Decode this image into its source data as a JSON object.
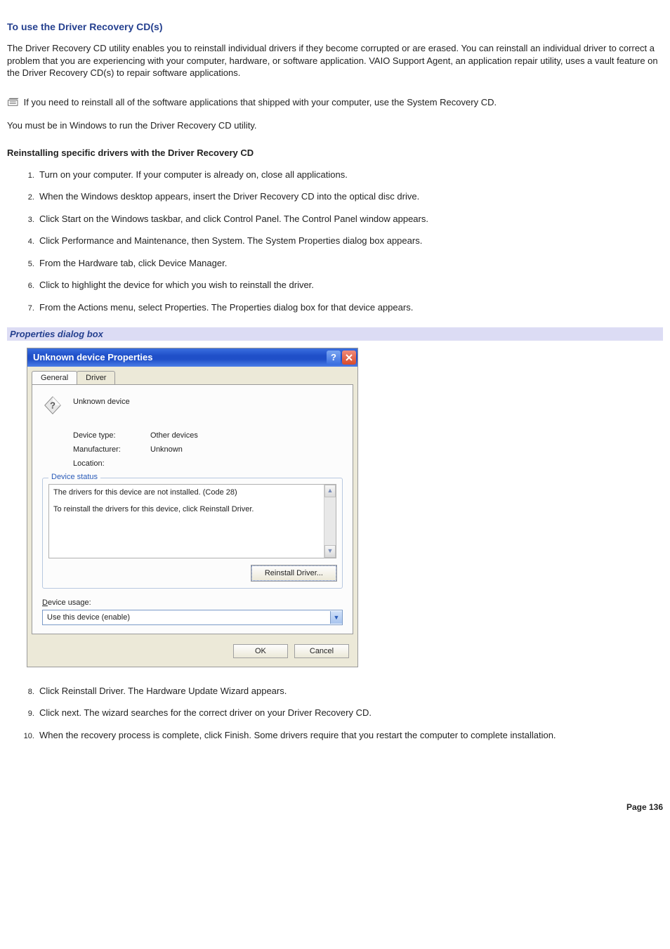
{
  "heading": "To use the Driver Recovery CD(s)",
  "intro": "The Driver Recovery CD utility enables you to reinstall individual drivers if they become corrupted or are erased. You can reinstall an individual driver to correct a problem that you are experiencing with your computer, hardware, or software application. VAIO Support Agent, an application repair utility, uses a vault feature on the Driver Recovery CD(s) to repair software applications.",
  "note": "If you need to reinstall all of the software applications that shipped with your computer, use the System Recovery CD.",
  "must_windows": "You must be in Windows to run the Driver Recovery CD utility.",
  "subheading": "Reinstalling specific drivers with the Driver Recovery CD",
  "steps_a": [
    "Turn on your computer. If your computer is already on, close all applications.",
    "When the Windows desktop appears, insert the Driver Recovery CD into the optical disc drive.",
    "Click Start on the Windows taskbar, and click Control Panel. The Control Panel window appears.",
    "Click Performance and Maintenance, then System. The System Properties dialog box appears.",
    "From the Hardware tab, click Device Manager.",
    "Click to highlight the device for which you wish to reinstall the driver.",
    "From the Actions menu, select Properties. The Properties dialog box for that device appears."
  ],
  "fig_caption": "Properties dialog box",
  "dialog": {
    "title": "Unknown device Properties",
    "tabs": {
      "general": "General",
      "driver": "Driver"
    },
    "device_name": "Unknown device",
    "rows": {
      "device_type_label": "Device type:",
      "device_type_value": "Other devices",
      "manufacturer_label": "Manufacturer:",
      "manufacturer_value": "Unknown",
      "location_label": "Location:",
      "location_value": ""
    },
    "status_legend": "Device status",
    "status_line1": "The drivers for this device are not installed. (Code 28)",
    "status_line2": "To reinstall the drivers for this device, click Reinstall Driver.",
    "reinstall_btn": "Reinstall Driver...",
    "usage_label_pre": "D",
    "usage_label_rest": "evice usage:",
    "usage_value": "Use this device (enable)",
    "ok": "OK",
    "cancel": "Cancel"
  },
  "steps_b": [
    "Click Reinstall Driver. The Hardware Update Wizard appears.",
    "Click next. The wizard searches for the correct driver on your Driver Recovery CD.",
    "When the recovery process is complete, click Finish. Some drivers require that you restart the computer to complete installation."
  ],
  "page_num": "Page 136"
}
